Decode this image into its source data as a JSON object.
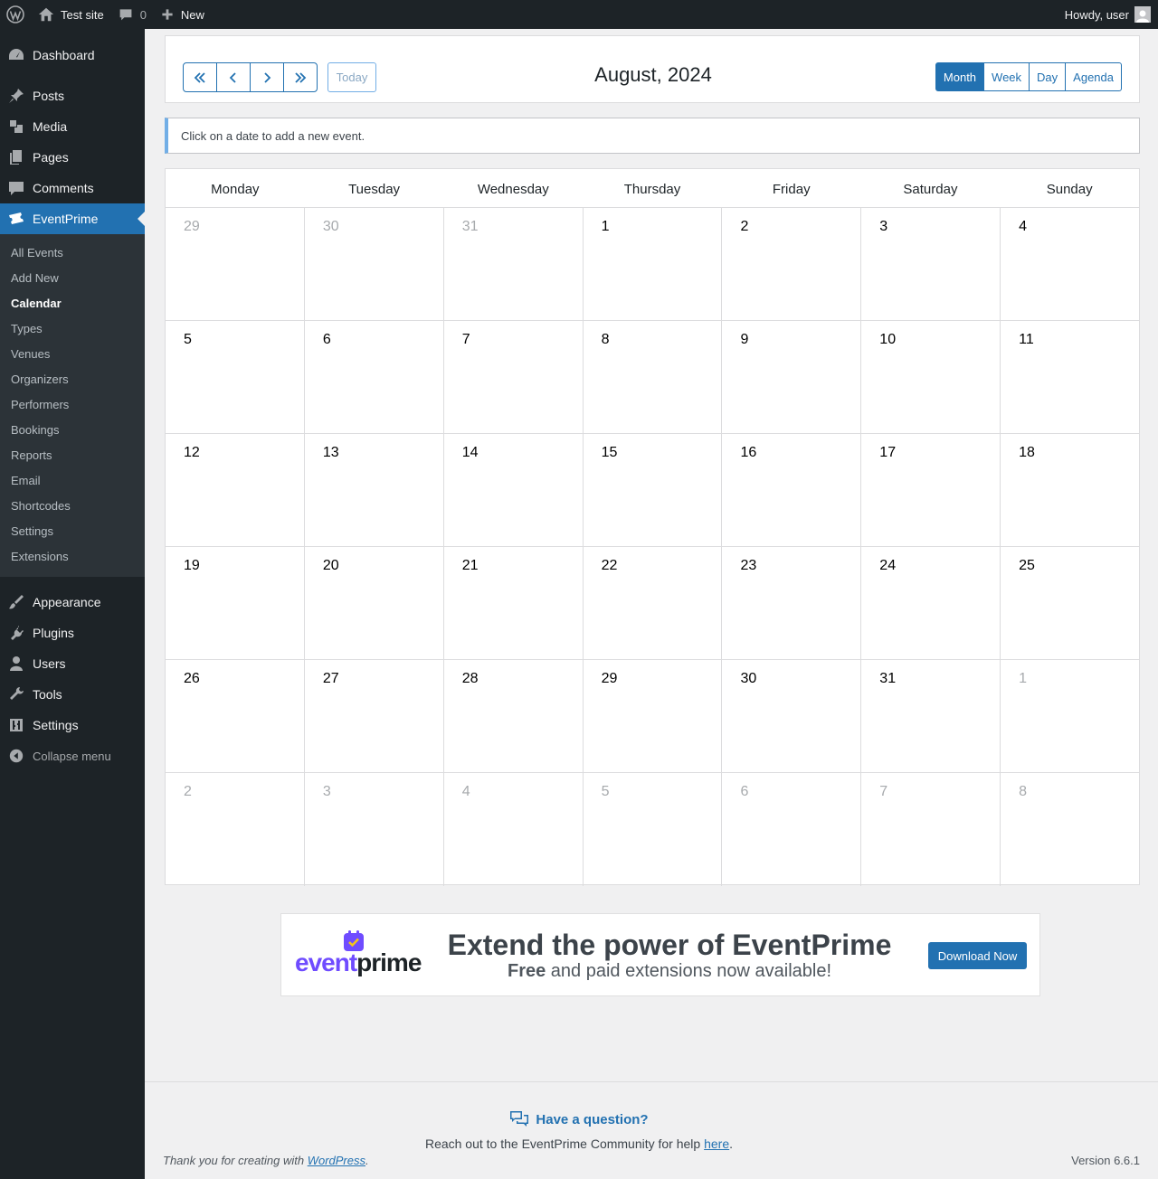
{
  "adminbar": {
    "site_name": "Test site",
    "comments_count": "0",
    "new_label": "New",
    "howdy": "Howdy, user"
  },
  "sidebar": {
    "items_top": [
      {
        "label": "Dashboard",
        "icon": "dashboard-icon"
      }
    ],
    "items_main": [
      {
        "label": "Posts",
        "icon": "pushpin-icon"
      },
      {
        "label": "Media",
        "icon": "media-icon"
      },
      {
        "label": "Pages",
        "icon": "pages-icon"
      },
      {
        "label": "Comments",
        "icon": "comment-icon"
      }
    ],
    "current": {
      "label": "EventPrime",
      "icon": "tickets-icon"
    },
    "submenu": [
      "All Events",
      "Add New",
      "Calendar",
      "Types",
      "Venues",
      "Organizers",
      "Performers",
      "Bookings",
      "Reports",
      "Email",
      "Shortcodes",
      "Settings",
      "Extensions"
    ],
    "submenu_current": "Calendar",
    "items_bottom": [
      {
        "label": "Appearance",
        "icon": "brush-icon"
      },
      {
        "label": "Plugins",
        "icon": "plugin-icon"
      },
      {
        "label": "Users",
        "icon": "users-icon"
      },
      {
        "label": "Tools",
        "icon": "wrench-icon"
      },
      {
        "label": "Settings",
        "icon": "settings-icon"
      }
    ],
    "collapse_label": "Collapse menu"
  },
  "calendar": {
    "title": "August, 2024",
    "today_label": "Today",
    "views": [
      "Month",
      "Week",
      "Day",
      "Agenda"
    ],
    "active_view": "Month",
    "notice": "Click on a date to add a new event.",
    "weekdays": [
      "Monday",
      "Tuesday",
      "Wednesday",
      "Thursday",
      "Friday",
      "Saturday",
      "Sunday"
    ],
    "weeks": [
      [
        {
          "d": "29",
          "o": true
        },
        {
          "d": "30",
          "o": true
        },
        {
          "d": "31",
          "o": true
        },
        {
          "d": "1"
        },
        {
          "d": "2"
        },
        {
          "d": "3"
        },
        {
          "d": "4"
        }
      ],
      [
        {
          "d": "5"
        },
        {
          "d": "6"
        },
        {
          "d": "7"
        },
        {
          "d": "8"
        },
        {
          "d": "9"
        },
        {
          "d": "10"
        },
        {
          "d": "11"
        }
      ],
      [
        {
          "d": "12"
        },
        {
          "d": "13"
        },
        {
          "d": "14"
        },
        {
          "d": "15"
        },
        {
          "d": "16"
        },
        {
          "d": "17"
        },
        {
          "d": "18"
        }
      ],
      [
        {
          "d": "19"
        },
        {
          "d": "20"
        },
        {
          "d": "21"
        },
        {
          "d": "22"
        },
        {
          "d": "23"
        },
        {
          "d": "24"
        },
        {
          "d": "25"
        }
      ],
      [
        {
          "d": "26"
        },
        {
          "d": "27"
        },
        {
          "d": "28"
        },
        {
          "d": "29"
        },
        {
          "d": "30"
        },
        {
          "d": "31"
        },
        {
          "d": "1",
          "o": true
        }
      ],
      [
        {
          "d": "2",
          "o": true
        },
        {
          "d": "3",
          "o": true
        },
        {
          "d": "4",
          "o": true
        },
        {
          "d": "5",
          "o": true
        },
        {
          "d": "6",
          "o": true
        },
        {
          "d": "7",
          "o": true
        },
        {
          "d": "8",
          "o": true
        }
      ]
    ]
  },
  "promo": {
    "logo_a": "event",
    "logo_b": "prime",
    "heading": "Extend the power of EventPrime",
    "sub_bold": "Free",
    "sub_rest": " and paid extensions now available!",
    "button": "Download Now"
  },
  "help": {
    "question": "Have a question?",
    "text_before": "Reach out to the EventPrime Community for help ",
    "link": "here",
    "text_after": "."
  },
  "footer": {
    "thanks_before": "Thank you for creating with ",
    "thanks_link": "WordPress",
    "thanks_after": ".",
    "version": "Version 6.6.1"
  },
  "colors": {
    "accent": "#2271b1",
    "sidebar_bg": "#1d2327",
    "submenu_bg": "#2c3338",
    "page_bg": "#f0f0f1"
  }
}
